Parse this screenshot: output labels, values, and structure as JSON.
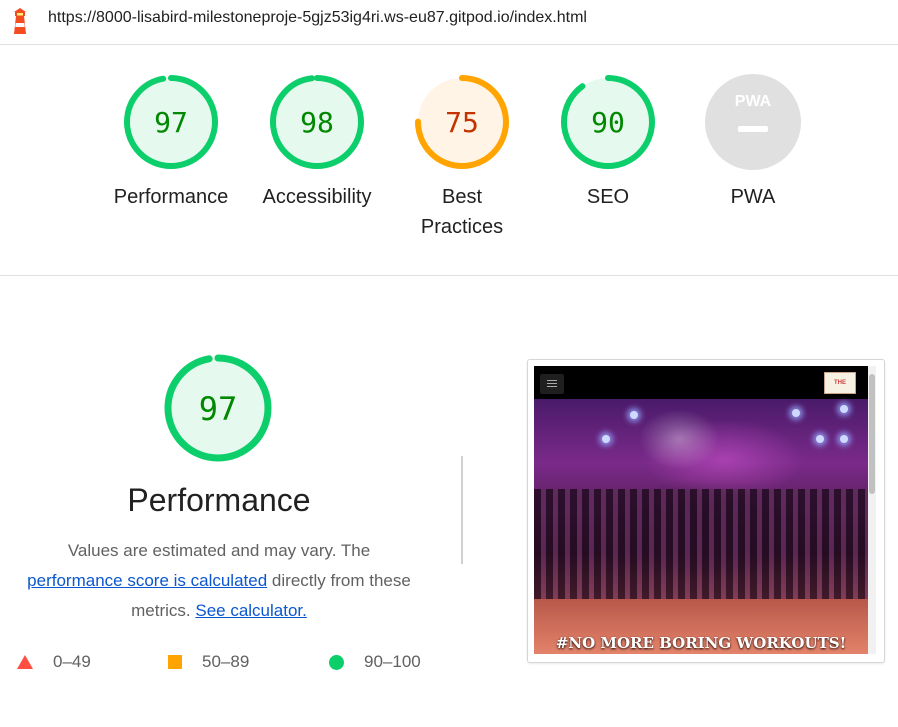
{
  "header": {
    "url": "https://8000-lisabird-milestoneproje-5gjz53ig4ri.ws-eu87.gitpod.io/index.html",
    "icon": "lighthouse-icon"
  },
  "gauges": [
    {
      "score": "97",
      "label": "Performance",
      "value": 97,
      "color": "#0cce6b",
      "fill": "#e6f9ee",
      "text_color": "#008800"
    },
    {
      "score": "98",
      "label": "Accessibility",
      "value": 98,
      "color": "#0cce6b",
      "fill": "#e6f9ee",
      "text_color": "#008800"
    },
    {
      "score": "75",
      "label": "Best",
      "label2": "Practices",
      "value": 75,
      "color": "#ffa400",
      "fill": "#fff4e5",
      "text_color": "#c33300"
    },
    {
      "score": "90",
      "label": "SEO",
      "value": 90,
      "color": "#0cce6b",
      "fill": "#e6f9ee",
      "text_color": "#008800"
    },
    {
      "score": "PWA",
      "label": "PWA",
      "value": 0,
      "color": "#e0e0e0",
      "fill": "#e0e0e0",
      "text_color": "#ffffff"
    }
  ],
  "performance": {
    "score": "97",
    "value": 97,
    "title": "Performance",
    "desc_pre": "Values are estimated and may vary. The",
    "link1": "performance score is calculated",
    "desc_mid": "directly from these metrics.",
    "link2": "See calculator."
  },
  "legend": [
    {
      "range": "0–49",
      "shape": "triangle",
      "color": "#ff4e42"
    },
    {
      "range": "50–89",
      "shape": "square",
      "color": "#ffa400"
    },
    {
      "range": "90–100",
      "shape": "circle",
      "color": "#0cce6b"
    }
  ],
  "screenshot": {
    "caption": "#NO MORE BORING WORKOUTS!",
    "logo_text": "THE STUDIO"
  }
}
